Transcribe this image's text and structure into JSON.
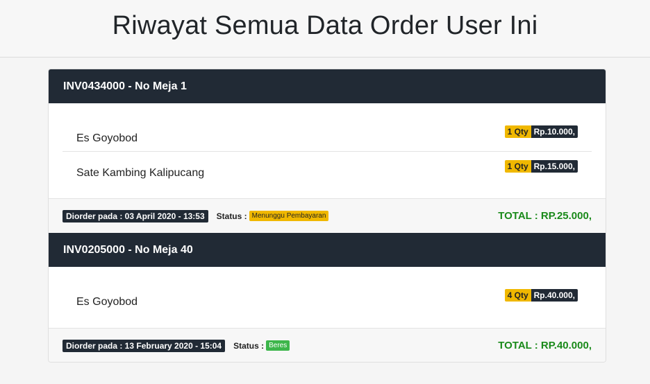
{
  "page": {
    "title": "Riwayat Semua Data Order User Ini"
  },
  "orders": [
    {
      "header": "INV0434000 - No Meja 1",
      "items": [
        {
          "name": "Es Goyobod",
          "qty": "1 Qty",
          "price": "Rp.10.000,"
        },
        {
          "name": "Sate Kambing Kalipucang",
          "qty": "1 Qty",
          "price": "Rp.15.000,"
        }
      ],
      "ordered_at": "Diorder pada : 03 April 2020 - 13:53",
      "status_label": "Status :",
      "status": "Menunggu Pembayaran",
      "total": "TOTAL : RP.25.000,"
    },
    {
      "header": "INV0205000 - No Meja 40",
      "items": [
        {
          "name": "Es Goyobod",
          "qty": "4 Qty",
          "price": "Rp.40.000,"
        }
      ],
      "ordered_at": "Diorder pada : 13 February 2020 - 15:04",
      "status_label": "Status :",
      "status": "Beres",
      "total": "TOTAL : RP.40.000,"
    }
  ],
  "colors": {
    "header_bg": "#212a35",
    "qty_badge": "#f0b800",
    "status_wait": "#f0b800",
    "status_done": "#3db64b",
    "total_text": "#1a8a1a"
  }
}
